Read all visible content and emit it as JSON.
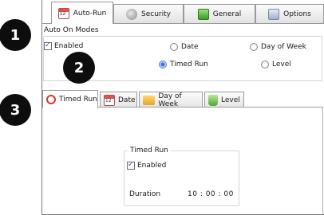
{
  "top_tabs": [
    {
      "label": "Auto-Run",
      "icon": "calendar-icon",
      "active": true
    },
    {
      "label": "Security",
      "icon": "lock-icon",
      "active": false
    },
    {
      "label": "General",
      "icon": "general-icon",
      "active": false
    },
    {
      "label": "Options",
      "icon": "options-icon",
      "active": false
    }
  ],
  "auto_on_modes": {
    "title": "Auto On Modes",
    "enabled_label": "Enabled",
    "enabled_checked": true,
    "modes": [
      {
        "label": "Date",
        "selected": false
      },
      {
        "label": "Day of Week",
        "selected": false
      },
      {
        "label": "Timed Run",
        "selected": true
      },
      {
        "label": "Level",
        "selected": false
      }
    ]
  },
  "sub_tabs": [
    {
      "label": "Timed Run",
      "icon": "clock-icon",
      "active": true
    },
    {
      "label": "Date",
      "icon": "calendar-icon",
      "active": false
    },
    {
      "label": "Day of Week",
      "icon": "folder-icon",
      "active": false
    },
    {
      "label": "Level",
      "icon": "level-icon",
      "active": false
    }
  ],
  "timed_run": {
    "title": "Timed Run",
    "enabled_label": "Enabled",
    "enabled_checked": true,
    "duration_label": "Duration",
    "duration_value": "10 : 00 : 00"
  },
  "callouts": [
    "1",
    "2",
    "3"
  ],
  "colors": {
    "accent": "#3a78d8",
    "callout_bg": "#0d0d0d",
    "border": "#9a9a9a"
  }
}
